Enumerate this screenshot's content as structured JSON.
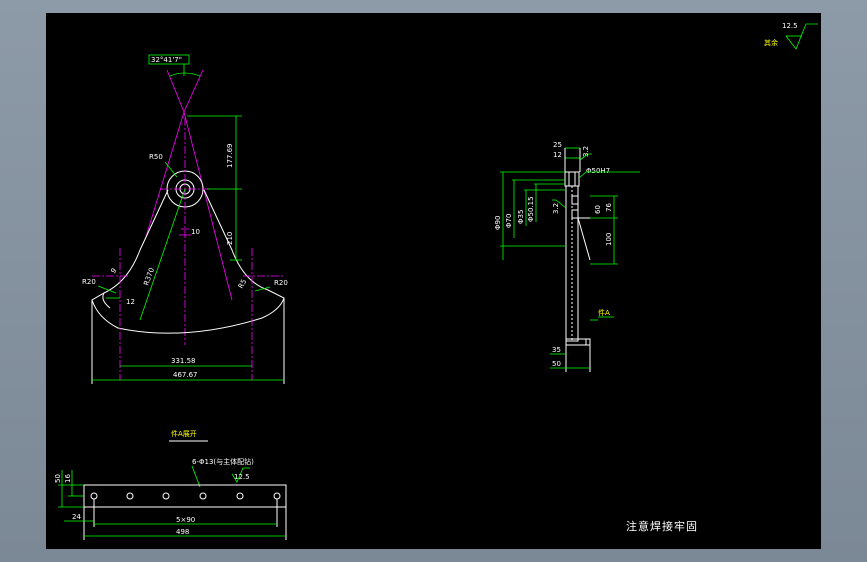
{
  "colors": {
    "background": "#000000",
    "frame": "#8b97a5",
    "dimension": "#00ff00",
    "outline": "#ffffff",
    "centerline": "#ff00ff",
    "text_yellow": "#ffff00"
  },
  "surface_finish": {
    "value": "12.5",
    "label": "其余"
  },
  "main_view": {
    "angle_label": "32°41'7\"",
    "radius_top": "R50",
    "height_dim": "177.69",
    "lower_dim": "210",
    "small_dim": "10",
    "radius_left": "R20",
    "radius_right": "R20",
    "left_small_a": "9",
    "left_small_b": "12",
    "arc_radius": "R370",
    "right_small": "R5",
    "inner_width": "331.58",
    "overall_width": "467.67"
  },
  "side_view": {
    "top_dim_1": "25",
    "top_dim_2": "12",
    "roughness_top": "3.2",
    "bore_note": "Φ50H7",
    "roughness_mid": "3.2",
    "dia_left_1": "Φ90",
    "dia_left_2": "Φ70",
    "dia_left_3": "Φ35",
    "dia_left_4": "Φ50.15",
    "right_dim_1": "76",
    "right_dim_2": "60",
    "right_dim_3": "100",
    "part_label": "件A",
    "bottom_dim_1": "35",
    "bottom_dim_2": "50"
  },
  "development_view": {
    "title": "件A展开",
    "hole_note": "6-Φ13(与主体配钻)",
    "roughness": "12.5",
    "height_1": "50",
    "height_2": "16",
    "left_offset": "24",
    "hole_spacing": "5×90",
    "overall_length": "498"
  },
  "footer_note": "注意焊接牢固"
}
